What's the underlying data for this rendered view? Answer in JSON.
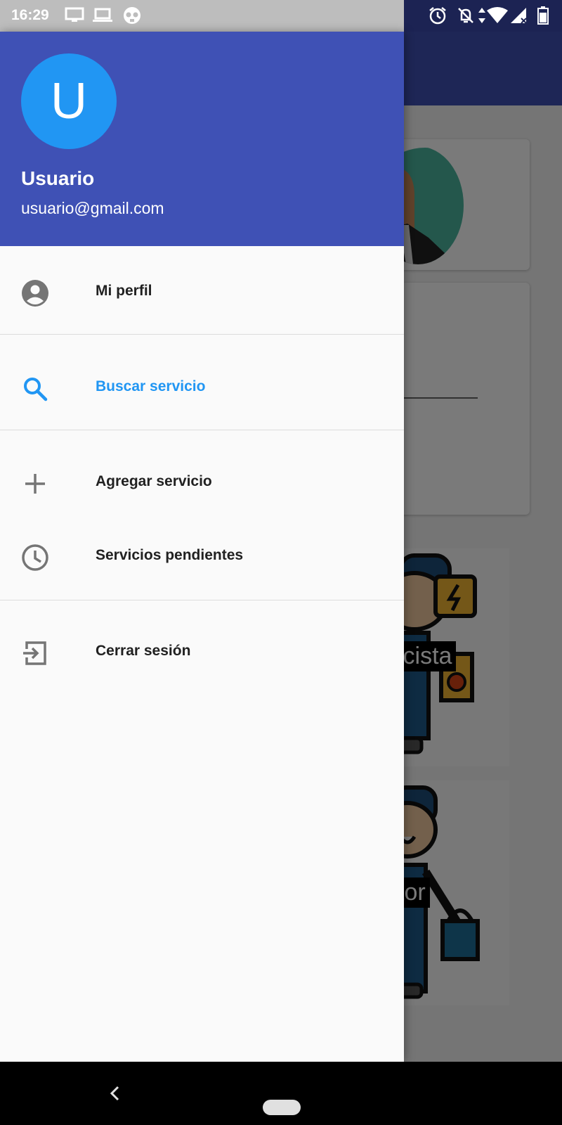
{
  "status_bar": {
    "time": "16:29",
    "left_icons": [
      "monitor-icon",
      "laptop-icon",
      "skull-icon"
    ],
    "right_icons": [
      "alarm-icon",
      "notifications-off-icon",
      "data-arrows-icon",
      "wifi-icon",
      "signal-icon",
      "battery-icon"
    ]
  },
  "drawer": {
    "header": {
      "avatar_letter": "U",
      "name": "Usuario",
      "email": "usuario@gmail.com",
      "background_color": "#3f51b5",
      "avatar_color": "#2196f3"
    },
    "items": [
      {
        "label": "Mi perfil",
        "icon": "account-circle-icon",
        "active": false
      },
      {
        "label": "Buscar servicio",
        "icon": "search-icon",
        "active": true
      },
      {
        "label": "Agregar servicio",
        "icon": "plus-icon",
        "active": false
      },
      {
        "label": "Servicios pendientes",
        "icon": "clock-icon",
        "active": false
      },
      {
        "label": "Cerrar sesión",
        "icon": "logout-icon",
        "active": false
      }
    ],
    "accent_color": "#2196f3"
  },
  "background": {
    "tiles": [
      "icista",
      "tor"
    ]
  },
  "nav_bar": {
    "icons": [
      "back-icon",
      "home-pill-icon"
    ]
  }
}
